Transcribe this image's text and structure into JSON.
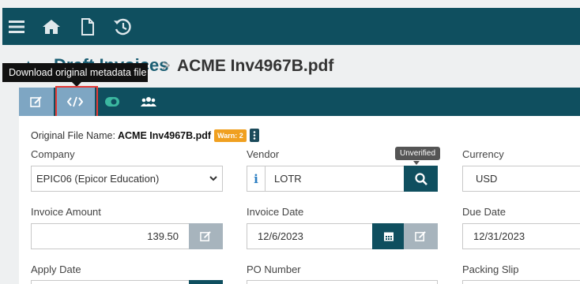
{
  "topbar": {
    "icons": [
      "menu-icon",
      "home-icon",
      "document-icon",
      "history-icon"
    ]
  },
  "breadcrumb": {
    "link": "Draft Invoices",
    "separator": ">",
    "title": "ACME Inv4967B.pdf"
  },
  "tooltip": {
    "text": "Download original metadata file"
  },
  "tabs": [
    "edit-icon",
    "code-icon",
    "toggle-icon",
    "users-icon"
  ],
  "file_info": {
    "label": "Original File Name:",
    "value": "ACME Inv4967B.pdf",
    "warn": "Warn: 2"
  },
  "form": {
    "company_label": "Company",
    "company_value": "EPIC06 (Epicor Education)",
    "vendor_label": "Vendor",
    "vendor_info": "i",
    "vendor_value": "LOTR",
    "vendor_tooltip": "Unverified",
    "currency_label": "Currency",
    "currency_value": "USD",
    "invoice_amount_label": "Invoice Amount",
    "invoice_amount_value": "139.50",
    "invoice_date_label": "Invoice Date",
    "invoice_date_value": "12/6/2023",
    "due_date_label": "Due Date",
    "due_date_value": "12/31/2023",
    "apply_date_label": "Apply Date",
    "po_number_label": "PO Number",
    "packing_slip_label": "Packing Slip"
  }
}
